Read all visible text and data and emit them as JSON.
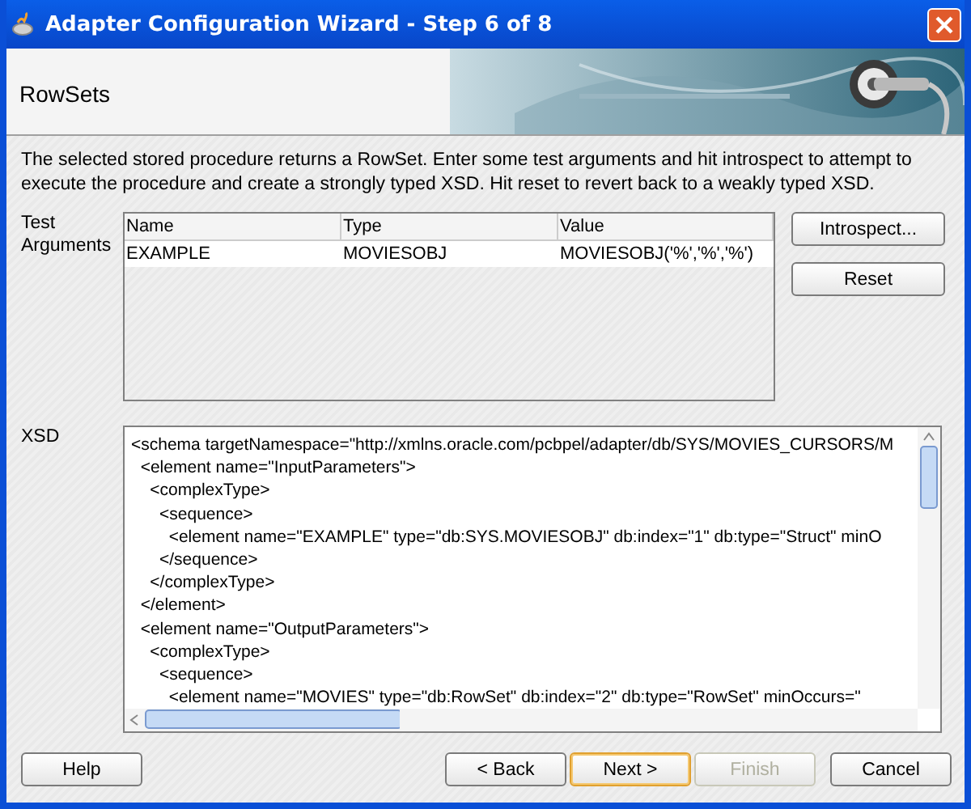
{
  "window": {
    "title": "Adapter Configuration Wizard - Step 6 of 8"
  },
  "header": {
    "title": "RowSets"
  },
  "description": "The selected stored procedure returns a RowSet.  Enter some test arguments and hit introspect to attempt to execute the procedure and create a strongly typed XSD.  Hit reset to revert back to a weakly typed XSD.",
  "test_arguments": {
    "label": "Test Arguments",
    "columns": [
      "Name",
      "Type",
      "Value"
    ],
    "rows": [
      [
        "EXAMPLE",
        "MOVIESOBJ",
        "MOVIESOBJ('%','%','%')"
      ]
    ],
    "buttons": [
      "Introspect...",
      "Reset"
    ]
  },
  "xsd": {
    "label": "XSD",
    "lines": [
      "<schema targetNamespace=\"http://xmlns.oracle.com/pcbpel/adapter/db/SYS/MOVIES_CURSORS/M",
      "  <element name=\"InputParameters\">",
      "    <complexType>",
      "      <sequence>",
      "        <element name=\"EXAMPLE\" type=\"db:SYS.MOVIESOBJ\" db:index=\"1\" db:type=\"Struct\" minO",
      "      </sequence>",
      "    </complexType>",
      "  </element>",
      "  <element name=\"OutputParameters\">",
      "    <complexType>",
      "      <sequence>",
      "        <element name=\"MOVIES\" type=\"db:RowSet\" db:index=\"2\" db:type=\"RowSet\" minOccurs=\""
    ]
  },
  "footer": {
    "help": "Help",
    "buttons": [
      {
        "label": "< Back",
        "disabled": false,
        "default": false
      },
      {
        "label": "Next >",
        "disabled": false,
        "default": true
      },
      {
        "label": "Finish",
        "disabled": true,
        "default": false
      },
      {
        "label": "Cancel",
        "disabled": false,
        "default": false
      }
    ]
  }
}
